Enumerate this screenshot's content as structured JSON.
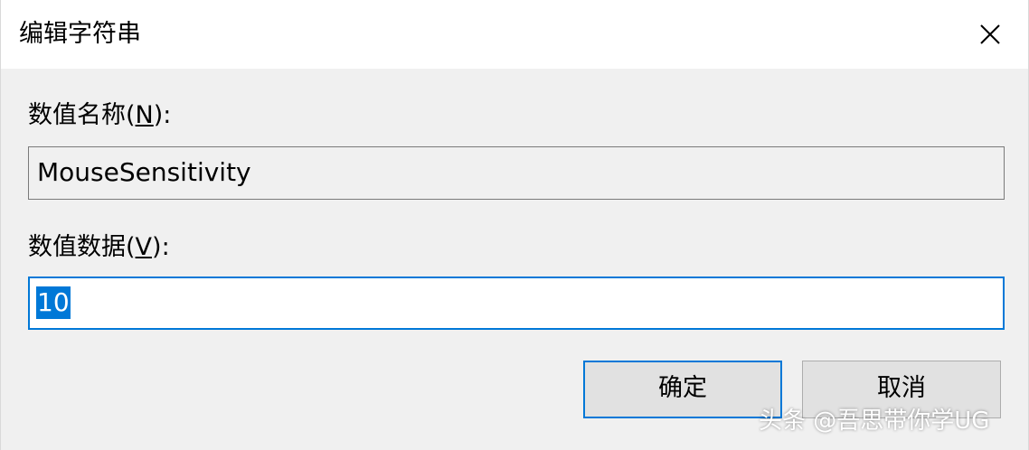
{
  "dialog": {
    "title": "编辑字符串",
    "close_icon": "close-icon"
  },
  "value_name": {
    "label_prefix": "数值名称(",
    "label_accel": "N",
    "label_suffix": "):",
    "value": "MouseSensitivity"
  },
  "value_data": {
    "label_prefix": "数值数据(",
    "label_accel": "V",
    "label_suffix": "):",
    "value": "10"
  },
  "buttons": {
    "ok_label": "确定",
    "cancel_label": "取消"
  },
  "watermark": "头条 @吾思带你学UG",
  "colors": {
    "accent": "#0078d7",
    "titlebar": "#ffffff",
    "background": "#f0f0f0",
    "button_face": "#e1e1e1"
  }
}
